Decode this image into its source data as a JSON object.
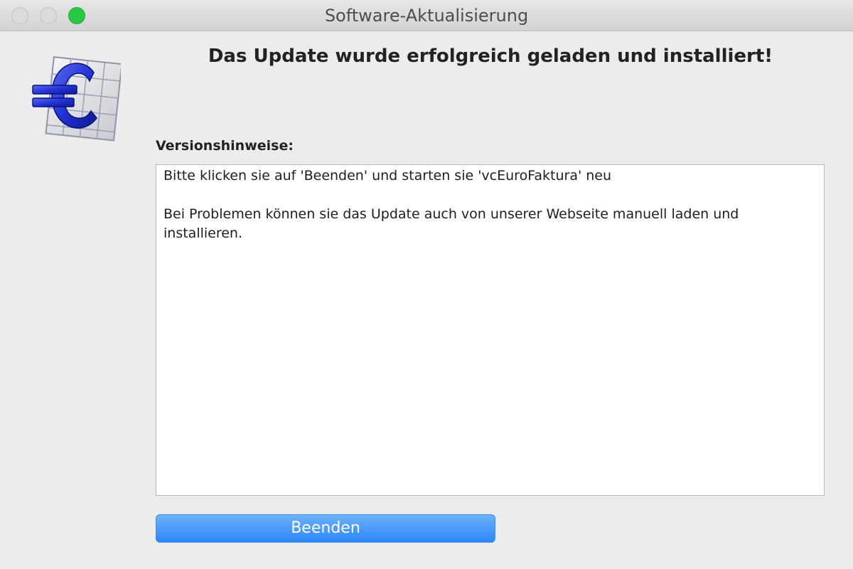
{
  "window": {
    "title": "Software-Aktualisierung"
  },
  "dialog": {
    "headline": "Das Update wurde erfolgreich geladen und installiert!",
    "notes_label": "Versionshinweise:",
    "notes_line1": "Bitte klicken sie auf 'Beenden' und starten sie 'vcEuroFaktura' neu",
    "notes_line2": "Bei Problemen können sie das Update auch von unserer Webseite manuell laden und installieren.",
    "quit_label": "Beenden"
  },
  "icons": {
    "app": "euro-calculator-icon"
  },
  "colors": {
    "accent": "#2a86f7",
    "zoom_button": "#28c940",
    "euro_blue": "#1f2fd6"
  }
}
